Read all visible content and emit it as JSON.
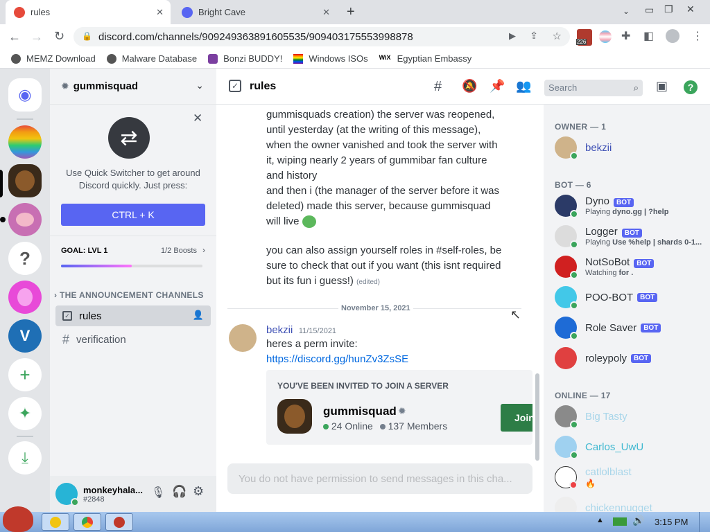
{
  "browser": {
    "tabs": [
      {
        "title": "rules"
      },
      {
        "title": "Bright Cave"
      }
    ],
    "url": "discord.com/channels/909249363891605535/909403175553998878",
    "extension_badge": "226",
    "bookmarks": [
      "MEMZ Download",
      "Malware Database",
      "Bonzi BUDDY!",
      "Windows ISOs",
      "Egyptian Embassy"
    ]
  },
  "server": {
    "name": "gummisquad",
    "quick_switcher_text": "Use Quick Switcher to get around Discord quickly. Just press:",
    "shortcut_button": "CTRL + K",
    "goal_label": "GOAL: LVL 1",
    "boosts_label": "Boosts",
    "boosts_count": "1/2",
    "boost_progress": 0.5,
    "category": "THE ANNOUNCEMENT CHANNELS",
    "channels": [
      {
        "name": "rules",
        "icon": "rules-checkbox-icon",
        "selected": true
      },
      {
        "name": "verification",
        "icon": "hash-icon",
        "selected": false
      }
    ],
    "user": {
      "name": "monkeyhala...",
      "tag": "#2848"
    }
  },
  "channel": {
    "name": "rules",
    "search_placeholder": "Search",
    "message_part1": "gummisquads creation) the server was reopened, until yesterday (at the writing of this message), when the owner vanished and took the server with it, wiping nearly 2 years of gummibar fan culture and history",
    "message_part2": "and then i (the manager of the server before it was deleted) made this server, because gummisquad will live",
    "message_part3": "you can also assign yourself roles in #self-roles, be sure to check that out if you want (this isnt required but its fun i guess!)",
    "edited_label": "(edited)",
    "date_divider": "November 15, 2021",
    "post": {
      "author": "bekzii",
      "timestamp": "11/15/2021",
      "text": "heres a perm invite:",
      "link": "https://discord.gg/hunZv3ZsSE"
    },
    "invite": {
      "header": "YOU'VE BEEN INVITED TO JOIN A SERVER",
      "server_name": "gummisquad",
      "online": "24 Online",
      "members": "137 Members",
      "join_label": "Join"
    },
    "input_placeholder": "You do not have permission to send messages in this cha..."
  },
  "members": {
    "owner_header": "OWNER — 1",
    "owner": [
      {
        "name": "bekzii"
      }
    ],
    "bot_header": "BOT — 6",
    "bots": [
      {
        "name": "Dyno",
        "badge": "BOT",
        "activity_prefix": "Playing",
        "activity": "dyno.gg | ?help",
        "color": "#2b3a67"
      },
      {
        "name": "Logger",
        "badge": "BOT",
        "activity_prefix": "Playing",
        "activity": "Use %help | shards 0-1...",
        "color": "#dcdcdc"
      },
      {
        "name": "NotSoBot",
        "badge": "BOT",
        "activity_prefix": "Watching",
        "activity": "for .",
        "color": "#d02020"
      },
      {
        "name": "POO-BOT",
        "badge": "BOT",
        "activity_prefix": "",
        "activity": "",
        "color": "#42c8e8"
      },
      {
        "name": "Role Saver",
        "badge": "BOT",
        "activity_prefix": "",
        "activity": "",
        "color": "#1e6bd6"
      },
      {
        "name": "roleypoly",
        "badge": "BOT",
        "activity_prefix": "",
        "activity": "",
        "color": "#e04040"
      }
    ],
    "online_header": "ONLINE — 17",
    "online": [
      {
        "name": "Big Tasty",
        "color": "#a9d6ea"
      },
      {
        "name": "Carlos_UwU",
        "color": "#3fb8d0"
      },
      {
        "name": "catlolblast",
        "color": "#a9d6ea"
      },
      {
        "name": "chickennugget",
        "color": "#a9d6ea"
      }
    ]
  },
  "taskbar": {
    "clock": "3:15 PM"
  }
}
